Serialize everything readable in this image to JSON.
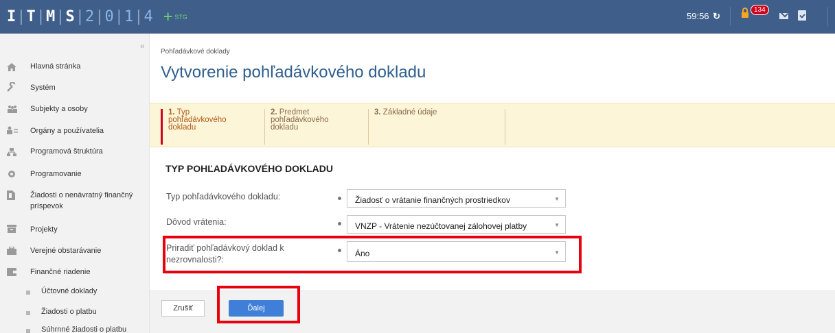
{
  "header": {
    "logo_text": "ITMS2014+",
    "env": "STG",
    "timer": "59:56",
    "notifications": "134"
  },
  "sidebar": {
    "items": [
      {
        "label": "Hlavná stránka",
        "icon": "home-icon"
      },
      {
        "label": "Systém",
        "icon": "wrench-icon"
      },
      {
        "label": "Subjekty a osoby",
        "icon": "people-icon"
      },
      {
        "label": "Orgány a používatelia",
        "icon": "users-list-icon"
      },
      {
        "label": "Programová štruktúra",
        "icon": "structure-icon"
      },
      {
        "label": "Programovanie",
        "icon": "gears-icon"
      },
      {
        "label": "Žiadosti o nenávratný finančný príspevok",
        "icon": "document-icon"
      },
      {
        "label": "Projekty",
        "icon": "archive-icon"
      },
      {
        "label": "Verejné obstarávanie",
        "icon": "briefcase-icon"
      },
      {
        "label": "Finančné riadenie",
        "icon": "wallet-icon"
      }
    ],
    "subitems": [
      {
        "label": "Účtovné doklady"
      },
      {
        "label": "Žiadosti o platbu"
      },
      {
        "label": "Súhrnné žiadosti o platbu"
      }
    ]
  },
  "main": {
    "breadcrumb": "Pohľadávkové doklady",
    "title": "Vytvorenie pohľadávkového dokladu",
    "steps": [
      {
        "num": "1.",
        "label_line1": "Typ",
        "label_line2": "pohľadávkového",
        "label_line3": "dokladu"
      },
      {
        "num": "2.",
        "label_line1": "Predmet",
        "label_line2": "pohľadávkového",
        "label_line3": "dokladu"
      },
      {
        "num": "3.",
        "label_line1": "Základné údaje"
      }
    ],
    "section_title": "TYP POHĽADÁVKOVÉHO DOKLADU",
    "fields": [
      {
        "label": "Typ pohľadávkového dokladu:",
        "value": "Žiadosť o vrátanie finančných prostriedkov"
      },
      {
        "label": "Dôvod vrátenia:",
        "value": "VNZP - Vrátenie nezúčtovanej zálohovej platby"
      },
      {
        "label": "Priradiť pohľadávkový doklad k nezrovnalosti?:",
        "value": "Áno"
      }
    ]
  },
  "footer": {
    "cancel_label": "Zrušiť",
    "next_label": "Ďalej"
  },
  "colors": {
    "topbar": "#3f5f8a",
    "accent": "#3f7fd8",
    "title": "#2f5f8f",
    "highlight": "#e8000c"
  }
}
